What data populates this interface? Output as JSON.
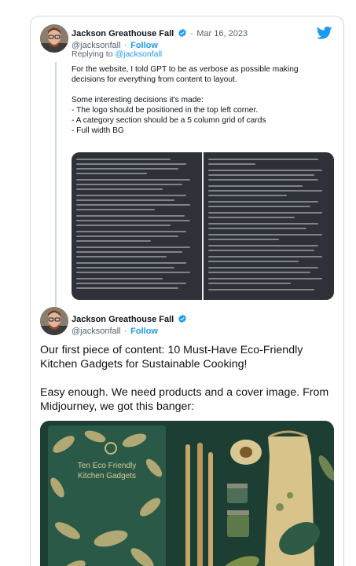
{
  "tweet1": {
    "author_name": "Jackson Greathouse Fall",
    "date_sep": "·",
    "date": "Mar 16, 2023",
    "handle": "@jacksonfall",
    "follow_sep": "·",
    "follow": "Follow",
    "reply_prefix": "Replying to",
    "reply_to": "@jacksonfall",
    "text": "For the website, I told GPT to be as verbose as possible making decisions for everything from content to layout.\n\nSome interesting decisions it's made:\n- The logo should be positioned in the top left corner.\n- A category section should be a 5 column grid of cards\n- Full width BG"
  },
  "tweet2": {
    "author_name": "Jackson Greathouse Fall",
    "handle": "@jacksonfall",
    "follow_sep": "·",
    "follow": "Follow",
    "text": "Our first piece of content: 10 Must-Have Eco-Friendly Kitchen Gadgets for Sustainable Cooking!\n\nEasy enough. We need products and a cover image. From Midjourney, we got this banger:",
    "image_text_line1": "Ten Eco Friendly",
    "image_text_line2": "Kitchen Gadgets"
  },
  "colors": {
    "accent": "#1d9bf0",
    "text": "#0f1419",
    "muted": "#536471",
    "border": "#cfd9de",
    "book_green": "#1f4a3a",
    "leaf_cream": "#d9c893"
  },
  "icons": [
    "twitter-bird-icon",
    "verified-badge-icon",
    "avatar-image"
  ]
}
